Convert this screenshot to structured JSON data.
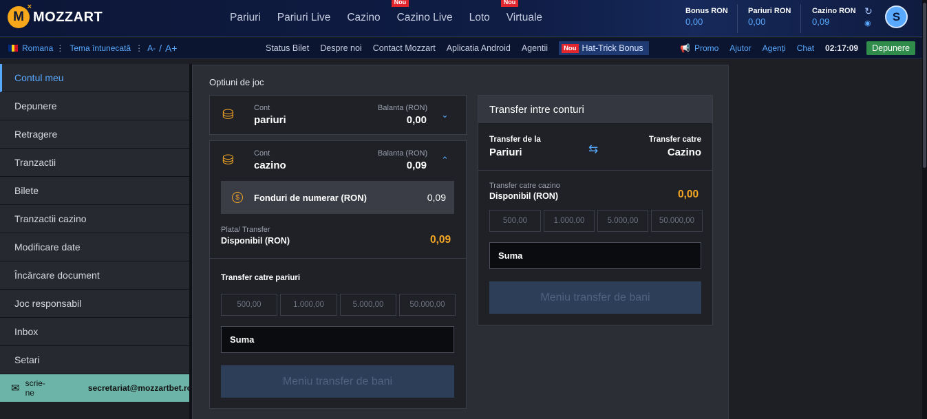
{
  "brand": {
    "logo_text": "MOZZART",
    "logo_mark": "M",
    "logo_x": "×"
  },
  "nav": [
    {
      "label": "Pariuri",
      "badge": ""
    },
    {
      "label": "Pariuri Live",
      "badge": ""
    },
    {
      "label": "Cazino",
      "badge": ""
    },
    {
      "label": "Cazino Live",
      "badge": "Nou"
    },
    {
      "label": "Loto",
      "badge": ""
    },
    {
      "label": "Virtuale",
      "badge": "Nou"
    }
  ],
  "balances": [
    {
      "label": "Bonus RON",
      "value": "0,00"
    },
    {
      "label": "Pariuri RON",
      "value": "0,00"
    },
    {
      "label": "Cazino RON",
      "value": "0,09"
    }
  ],
  "user": {
    "avatar_letter": "S"
  },
  "subbar": {
    "language": "Romana",
    "theme": "Tema întunecată",
    "font_small": "A-",
    "font_slash": "/",
    "font_big": "A+",
    "links": [
      "Status Bilet",
      "Despre noi",
      "Contact Mozzart",
      "Aplicatia Android",
      "Agentii"
    ],
    "hat_badge": "Nou",
    "hat_label": "Hat-Trick Bonus",
    "right_links": [
      "Promo",
      "Ajutor",
      "Agenți",
      "Chat"
    ],
    "clock": "02:17:09",
    "deposit": "Depunere"
  },
  "sidebar": [
    "Contul meu",
    "Depunere",
    "Retragere",
    "Tranzactii",
    "Bilete",
    "Tranzactii cazino",
    "Modificare date",
    "Încărcare document",
    "Joc responsabil",
    "Inbox",
    "Setari"
  ],
  "contact": {
    "label": "scrie-ne",
    "email": "secretariat@mozzartbet.ro"
  },
  "main": {
    "title": "Optiuni de joc",
    "acc1": {
      "cont": "Cont",
      "name": "pariuri",
      "bal_label": "Balanta (RON)",
      "bal": "0,00"
    },
    "acc2": {
      "cont": "Cont",
      "name": "cazino",
      "bal_label": "Balanta (RON)",
      "bal": "0,09"
    },
    "fund": {
      "label": "Fonduri de numerar (RON)",
      "value": "0,09",
      "symbol": "$"
    },
    "plata_label": "Plata/ Transfer",
    "disp_label": "Disponibil (RON)",
    "disp_value": "0,09",
    "transfer_label": "Transfer catre pariuri",
    "quick": [
      "500,00",
      "1.000,00",
      "5.000,00",
      "50.000,00"
    ],
    "suma": "Suma",
    "button": "Meniu transfer de bani"
  },
  "transfer": {
    "title": "Transfer intre conturi",
    "from_label": "Transfer de la",
    "from": "Pariuri",
    "to_label": "Transfer catre",
    "to": "Cazino",
    "line1": "Transfer catre cazino",
    "line2": "Disponibil (RON)",
    "value": "0,00",
    "quick": [
      "500,00",
      "1.000,00",
      "5.000,00",
      "50.000,00"
    ],
    "suma": "Suma",
    "button": "Meniu transfer de bani"
  },
  "colors": {
    "accent": "#58a9ff",
    "orange": "#f5a623",
    "deposit_green": "#2f8c4a",
    "contact_teal": "#6cb4a8",
    "badge_red": "#e1262d"
  }
}
